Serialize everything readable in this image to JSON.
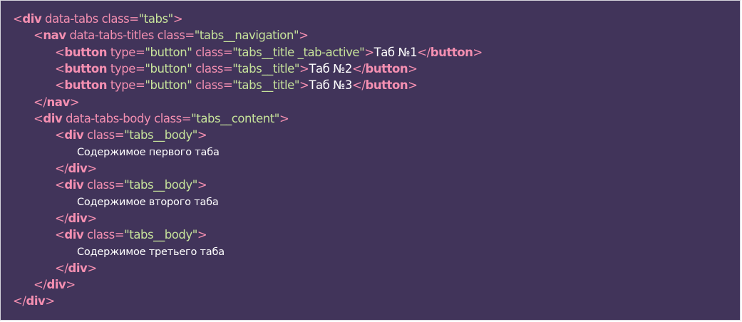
{
  "code": {
    "lines": [
      {
        "tokens": [
          {
            "type": "punct",
            "text": "<"
          },
          {
            "type": "tag",
            "text": "div"
          },
          {
            "type": "attr",
            "text": " data-tabs class="
          },
          {
            "type": "str",
            "text": "\"tabs\""
          },
          {
            "type": "punct",
            "text": ">"
          }
        ]
      },
      {
        "tokens": [
          {
            "type": "punct",
            "text": "<"
          },
          {
            "type": "tag",
            "text": "nav"
          },
          {
            "type": "attr",
            "text": " data-tabs-titles class="
          },
          {
            "type": "str",
            "text": "\"tabs__navigation\""
          },
          {
            "type": "punct",
            "text": ">"
          }
        ]
      },
      {
        "tokens": [
          {
            "type": "punct",
            "text": "<"
          },
          {
            "type": "tag",
            "text": "button"
          },
          {
            "type": "attr",
            "text": " type="
          },
          {
            "type": "str",
            "text": "\"button\""
          },
          {
            "type": "attr",
            "text": " class="
          },
          {
            "type": "str",
            "text": "\"tabs__title _tab-active\""
          },
          {
            "type": "punct",
            "text": ">"
          },
          {
            "type": "text",
            "text": "Таб №1"
          },
          {
            "type": "punct",
            "text": "</"
          },
          {
            "type": "tag",
            "text": "button"
          },
          {
            "type": "punct",
            "text": ">"
          }
        ]
      },
      {
        "tokens": [
          {
            "type": "punct",
            "text": "<"
          },
          {
            "type": "tag",
            "text": "button"
          },
          {
            "type": "attr",
            "text": " type="
          },
          {
            "type": "str",
            "text": "\"button\""
          },
          {
            "type": "attr",
            "text": " class="
          },
          {
            "type": "str",
            "text": "\"tabs__title\""
          },
          {
            "type": "punct",
            "text": ">"
          },
          {
            "type": "text",
            "text": "Таб №2"
          },
          {
            "type": "punct",
            "text": "</"
          },
          {
            "type": "tag",
            "text": "button"
          },
          {
            "type": "punct",
            "text": ">"
          }
        ]
      },
      {
        "tokens": [
          {
            "type": "punct",
            "text": "<"
          },
          {
            "type": "tag",
            "text": "button"
          },
          {
            "type": "attr",
            "text": " type="
          },
          {
            "type": "str",
            "text": "\"button\""
          },
          {
            "type": "attr",
            "text": " class="
          },
          {
            "type": "str",
            "text": "\"tabs__title\""
          },
          {
            "type": "punct",
            "text": ">"
          },
          {
            "type": "text",
            "text": "Таб №3"
          },
          {
            "type": "punct",
            "text": "</"
          },
          {
            "type": "tag",
            "text": "button"
          },
          {
            "type": "punct",
            "text": ">"
          }
        ]
      },
      {
        "tokens": [
          {
            "type": "punct",
            "text": "</"
          },
          {
            "type": "tag",
            "text": "nav"
          },
          {
            "type": "punct",
            "text": ">"
          }
        ]
      },
      {
        "tokens": [
          {
            "type": "punct",
            "text": "<"
          },
          {
            "type": "tag",
            "text": "div"
          },
          {
            "type": "attr",
            "text": " data-tabs-body class="
          },
          {
            "type": "str",
            "text": "\"tabs__content\""
          },
          {
            "type": "punct",
            "text": ">"
          }
        ]
      },
      {
        "tokens": [
          {
            "type": "punct",
            "text": "<"
          },
          {
            "type": "tag",
            "text": "div"
          },
          {
            "type": "attr",
            "text": " class="
          },
          {
            "type": "str",
            "text": "\"tabs__body\""
          },
          {
            "type": "punct",
            "text": ">"
          }
        ]
      },
      {
        "tokens": [
          {
            "type": "text",
            "text": "Содержимое первого таба"
          }
        ]
      },
      {
        "tokens": [
          {
            "type": "punct",
            "text": "</"
          },
          {
            "type": "tag",
            "text": "div"
          },
          {
            "type": "punct",
            "text": ">"
          }
        ]
      },
      {
        "tokens": [
          {
            "type": "punct",
            "text": "<"
          },
          {
            "type": "tag",
            "text": "div"
          },
          {
            "type": "attr",
            "text": " class="
          },
          {
            "type": "str",
            "text": "\"tabs__body\""
          },
          {
            "type": "punct",
            "text": ">"
          }
        ]
      },
      {
        "tokens": [
          {
            "type": "text",
            "text": "Содержимое второго таба"
          }
        ]
      },
      {
        "tokens": [
          {
            "type": "punct",
            "text": "</"
          },
          {
            "type": "tag",
            "text": "div"
          },
          {
            "type": "punct",
            "text": ">"
          }
        ]
      },
      {
        "tokens": [
          {
            "type": "punct",
            "text": "<"
          },
          {
            "type": "tag",
            "text": "div"
          },
          {
            "type": "attr",
            "text": " class="
          },
          {
            "type": "str",
            "text": "\"tabs__body\""
          },
          {
            "type": "punct",
            "text": ">"
          }
        ]
      },
      {
        "tokens": [
          {
            "type": "text",
            "text": "Содержимое третьего таба"
          }
        ]
      },
      {
        "tokens": [
          {
            "type": "punct",
            "text": "</"
          },
          {
            "type": "tag",
            "text": "div"
          },
          {
            "type": "punct",
            "text": ">"
          }
        ]
      },
      {
        "tokens": [
          {
            "type": "punct",
            "text": "</"
          },
          {
            "type": "tag",
            "text": "div"
          },
          {
            "type": "punct",
            "text": ">"
          }
        ]
      },
      {
        "tokens": [
          {
            "type": "punct",
            "text": "</"
          },
          {
            "type": "tag",
            "text": "div"
          },
          {
            "type": "punct",
            "text": ">"
          }
        ]
      }
    ]
  },
  "colors": {
    "background": "#41345a",
    "tag": "#f48fb1",
    "string": "#c6e29a",
    "text": "#ffffff"
  }
}
